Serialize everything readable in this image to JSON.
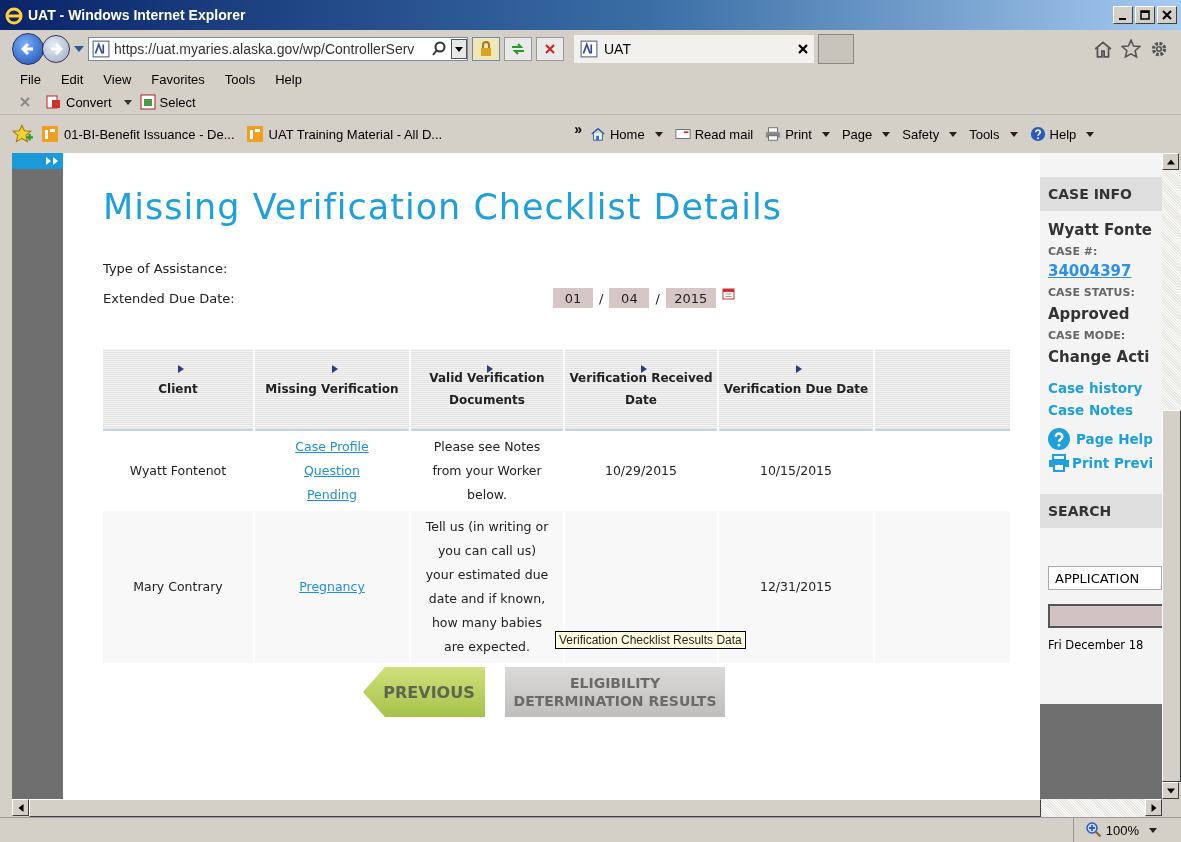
{
  "window": {
    "title": "UAT - Windows Internet Explorer"
  },
  "address_bar": {
    "url": "https://uat.myaries.alaska.gov/wp/ControllerServ"
  },
  "browser_tabs": [
    {
      "label": "UAT",
      "selected": true
    }
  ],
  "menu": [
    "File",
    "Edit",
    "View",
    "Favorites",
    "Tools",
    "Help"
  ],
  "command_bar": [
    {
      "label": "Convert",
      "kind": "pdf",
      "dropdown": true
    },
    {
      "label": "Select",
      "kind": "select",
      "dropdown": false
    }
  ],
  "favorites": [
    "01-BI-Benefit Issuance - De...",
    "UAT Training Material - All D..."
  ],
  "overflow": "»",
  "commands": [
    {
      "label": "Home",
      "kind": "home",
      "dropdown": true
    },
    {
      "label": "Read mail",
      "kind": "mail",
      "dropdown": false
    },
    {
      "label": "Print",
      "kind": "print",
      "dropdown": true
    },
    {
      "label": "Page",
      "kind": "plain",
      "dropdown": true
    },
    {
      "label": "Safety",
      "kind": "plain",
      "dropdown": true
    },
    {
      "label": "Tools",
      "kind": "plain",
      "dropdown": true
    },
    {
      "label": "Help",
      "kind": "help",
      "dropdown": true
    }
  ],
  "page": {
    "title": "Missing Verification Checklist Details",
    "fields": [
      {
        "label": "Type of Assistance:"
      },
      {
        "label": "Extended Due Date:",
        "date": {
          "month": "01",
          "day": "04",
          "year": "2015",
          "separator": "/"
        }
      }
    ],
    "table": {
      "columns": [
        "Client",
        "Missing Verification",
        "Valid Verification Documents",
        "Verification Received Date",
        "Verification Due Date"
      ],
      "rows": [
        {
          "client": "Wyatt Fontenot",
          "missing": [
            "Case Profile",
            "Question",
            "Pending"
          ],
          "documents": "Please see Notes from your Worker below.",
          "received": "10/29/2015",
          "due": "10/15/2015"
        },
        {
          "client": "Mary Contrary",
          "missing": [
            "Pregnancy"
          ],
          "documents": "Tell us (in writing or you can call us) your estimated due date and if known, how many babies are expected.",
          "due": "12/31/2015"
        }
      ]
    },
    "tooltip": "Verification Checklist Results Data",
    "buttons": [
      {
        "label": "PREVIOUS",
        "kind": "back"
      },
      {
        "label": "ELIGIBILITY DETERMINATION RESULTS",
        "kind": "next"
      }
    ]
  },
  "sidebar": {
    "case_info": {
      "heading": "CASE INFO",
      "name": "Wyatt Fonte",
      "fields": [
        {
          "label": "CASE #:",
          "value": "34004397",
          "kind": "link"
        },
        {
          "label": "CASE STATUS:",
          "value": "Approved",
          "kind": "text"
        },
        {
          "label": "CASE MODE:",
          "value": "Change Acti",
          "kind": "text"
        }
      ]
    },
    "links": [
      {
        "label": "Case history",
        "kind": "plain"
      },
      {
        "label": "Case Notes",
        "kind": "plain"
      },
      {
        "label": "Page Help",
        "kind": "help"
      },
      {
        "label": "Print Previ",
        "kind": "print"
      }
    ],
    "search": {
      "heading": "SEARCH",
      "type": "APPLICATION"
    },
    "date": "Fri December 18"
  },
  "status_bar": {
    "zoom": "100%"
  }
}
